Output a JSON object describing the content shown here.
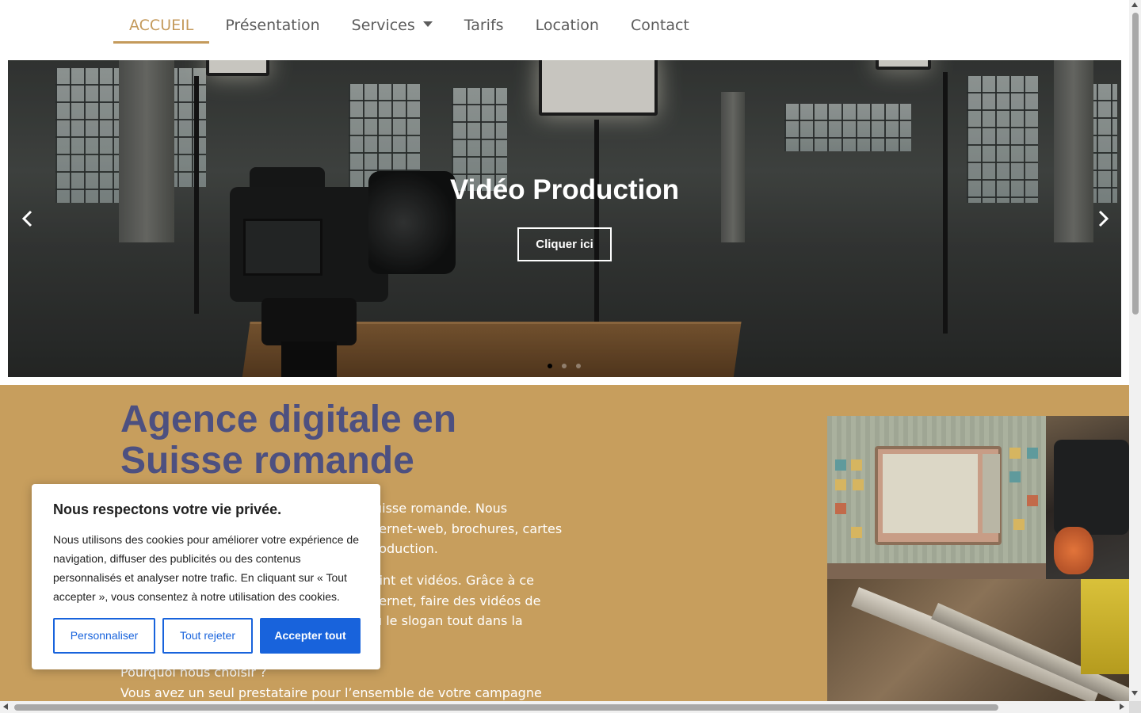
{
  "nav": {
    "items": [
      {
        "label": "ACCUEIL",
        "active": true
      },
      {
        "label": "Présentation"
      },
      {
        "label": "Services",
        "has_dropdown": true
      },
      {
        "label": "Tarifs"
      },
      {
        "label": "Location"
      },
      {
        "label": "Contact"
      }
    ],
    "accent_color": "#c49a5b"
  },
  "hero": {
    "title": "Vidéo Production",
    "button_label": "Cliquer ici",
    "prev_icon": "chevron-left-icon",
    "next_icon": "chevron-right-icon",
    "slides_count": 3,
    "active_slide": 1
  },
  "section": {
    "background_color": "#c79e5d",
    "title_color": "#4d5080",
    "title": "Agence digitale en Suisse romande",
    "paragraph_1": "uisse romande. Nous ternet-web, brochures, cartes roduction.",
    "paragraph_1_lines": [
      "uisse romande. Nous",
      "ternet-web, brochures, cartes",
      "roduction."
    ],
    "paragraph_2_lines": [
      "rint et vidéos. Grâce à ce",
      "ternet, faire des vidéos de",
      "ù le slogan tout dans la"
    ],
    "why_line": "Pourquoi nous choisir ?",
    "last_line": "Vous avez un seul prestataire pour l’ensemble de votre campagne qui"
  },
  "cookie": {
    "title": "Nous respectons votre vie privée.",
    "text": "Nous utilisons des cookies pour améliorer votre expérience de navigation, diffuser des publicités ou des contenus personnalisés et analyser notre trafic. En cliquant sur « Tout accepter », vous consentez à notre utilisation des cookies.",
    "buttons": {
      "customize": "Personnaliser",
      "reject": "Tout rejeter",
      "accept": "Accepter tout"
    },
    "button_color": "#1863dc"
  }
}
